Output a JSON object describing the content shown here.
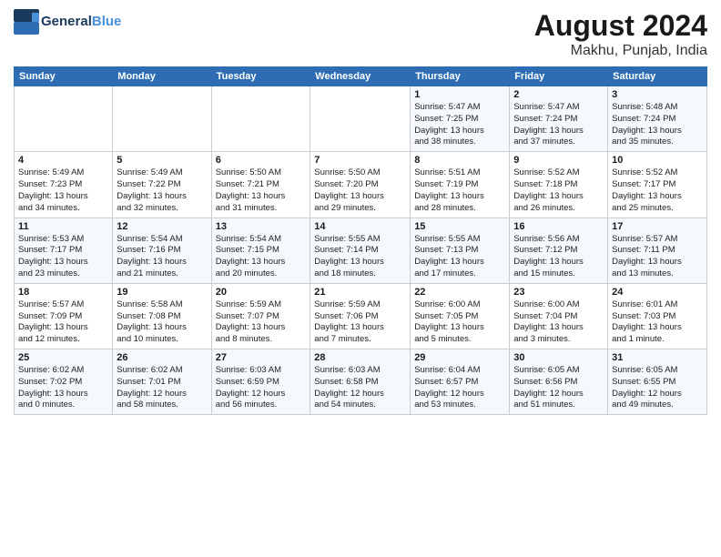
{
  "header": {
    "logo_line1": "General",
    "logo_line2": "Blue",
    "month_year": "August 2024",
    "location": "Makhu, Punjab, India"
  },
  "weekdays": [
    "Sunday",
    "Monday",
    "Tuesday",
    "Wednesday",
    "Thursday",
    "Friday",
    "Saturday"
  ],
  "weeks": [
    [
      {
        "day": "",
        "info": ""
      },
      {
        "day": "",
        "info": ""
      },
      {
        "day": "",
        "info": ""
      },
      {
        "day": "",
        "info": ""
      },
      {
        "day": "1",
        "info": "Sunrise: 5:47 AM\nSunset: 7:25 PM\nDaylight: 13 hours\nand 38 minutes."
      },
      {
        "day": "2",
        "info": "Sunrise: 5:47 AM\nSunset: 7:24 PM\nDaylight: 13 hours\nand 37 minutes."
      },
      {
        "day": "3",
        "info": "Sunrise: 5:48 AM\nSunset: 7:24 PM\nDaylight: 13 hours\nand 35 minutes."
      }
    ],
    [
      {
        "day": "4",
        "info": "Sunrise: 5:49 AM\nSunset: 7:23 PM\nDaylight: 13 hours\nand 34 minutes."
      },
      {
        "day": "5",
        "info": "Sunrise: 5:49 AM\nSunset: 7:22 PM\nDaylight: 13 hours\nand 32 minutes."
      },
      {
        "day": "6",
        "info": "Sunrise: 5:50 AM\nSunset: 7:21 PM\nDaylight: 13 hours\nand 31 minutes."
      },
      {
        "day": "7",
        "info": "Sunrise: 5:50 AM\nSunset: 7:20 PM\nDaylight: 13 hours\nand 29 minutes."
      },
      {
        "day": "8",
        "info": "Sunrise: 5:51 AM\nSunset: 7:19 PM\nDaylight: 13 hours\nand 28 minutes."
      },
      {
        "day": "9",
        "info": "Sunrise: 5:52 AM\nSunset: 7:18 PM\nDaylight: 13 hours\nand 26 minutes."
      },
      {
        "day": "10",
        "info": "Sunrise: 5:52 AM\nSunset: 7:17 PM\nDaylight: 13 hours\nand 25 minutes."
      }
    ],
    [
      {
        "day": "11",
        "info": "Sunrise: 5:53 AM\nSunset: 7:17 PM\nDaylight: 13 hours\nand 23 minutes."
      },
      {
        "day": "12",
        "info": "Sunrise: 5:54 AM\nSunset: 7:16 PM\nDaylight: 13 hours\nand 21 minutes."
      },
      {
        "day": "13",
        "info": "Sunrise: 5:54 AM\nSunset: 7:15 PM\nDaylight: 13 hours\nand 20 minutes."
      },
      {
        "day": "14",
        "info": "Sunrise: 5:55 AM\nSunset: 7:14 PM\nDaylight: 13 hours\nand 18 minutes."
      },
      {
        "day": "15",
        "info": "Sunrise: 5:55 AM\nSunset: 7:13 PM\nDaylight: 13 hours\nand 17 minutes."
      },
      {
        "day": "16",
        "info": "Sunrise: 5:56 AM\nSunset: 7:12 PM\nDaylight: 13 hours\nand 15 minutes."
      },
      {
        "day": "17",
        "info": "Sunrise: 5:57 AM\nSunset: 7:11 PM\nDaylight: 13 hours\nand 13 minutes."
      }
    ],
    [
      {
        "day": "18",
        "info": "Sunrise: 5:57 AM\nSunset: 7:09 PM\nDaylight: 13 hours\nand 12 minutes."
      },
      {
        "day": "19",
        "info": "Sunrise: 5:58 AM\nSunset: 7:08 PM\nDaylight: 13 hours\nand 10 minutes."
      },
      {
        "day": "20",
        "info": "Sunrise: 5:59 AM\nSunset: 7:07 PM\nDaylight: 13 hours\nand 8 minutes."
      },
      {
        "day": "21",
        "info": "Sunrise: 5:59 AM\nSunset: 7:06 PM\nDaylight: 13 hours\nand 7 minutes."
      },
      {
        "day": "22",
        "info": "Sunrise: 6:00 AM\nSunset: 7:05 PM\nDaylight: 13 hours\nand 5 minutes."
      },
      {
        "day": "23",
        "info": "Sunrise: 6:00 AM\nSunset: 7:04 PM\nDaylight: 13 hours\nand 3 minutes."
      },
      {
        "day": "24",
        "info": "Sunrise: 6:01 AM\nSunset: 7:03 PM\nDaylight: 13 hours\nand 1 minute."
      }
    ],
    [
      {
        "day": "25",
        "info": "Sunrise: 6:02 AM\nSunset: 7:02 PM\nDaylight: 13 hours\nand 0 minutes."
      },
      {
        "day": "26",
        "info": "Sunrise: 6:02 AM\nSunset: 7:01 PM\nDaylight: 12 hours\nand 58 minutes."
      },
      {
        "day": "27",
        "info": "Sunrise: 6:03 AM\nSunset: 6:59 PM\nDaylight: 12 hours\nand 56 minutes."
      },
      {
        "day": "28",
        "info": "Sunrise: 6:03 AM\nSunset: 6:58 PM\nDaylight: 12 hours\nand 54 minutes."
      },
      {
        "day": "29",
        "info": "Sunrise: 6:04 AM\nSunset: 6:57 PM\nDaylight: 12 hours\nand 53 minutes."
      },
      {
        "day": "30",
        "info": "Sunrise: 6:05 AM\nSunset: 6:56 PM\nDaylight: 12 hours\nand 51 minutes."
      },
      {
        "day": "31",
        "info": "Sunrise: 6:05 AM\nSunset: 6:55 PM\nDaylight: 12 hours\nand 49 minutes."
      }
    ]
  ]
}
